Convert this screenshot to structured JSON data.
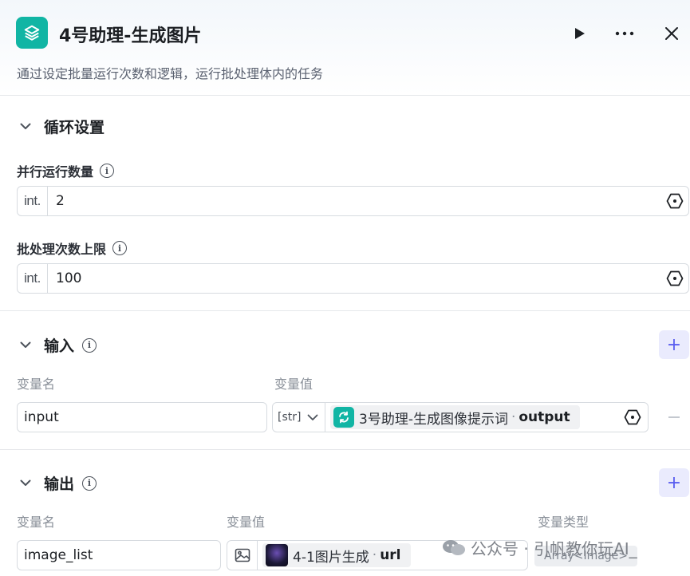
{
  "header": {
    "title": "4号助理-生成图片",
    "description": "通过设定批量运行次数和逻辑，运行批处理体内的任务"
  },
  "loop": {
    "section_title": "循环设置",
    "parallel": {
      "label": "并行运行数量",
      "type": "int.",
      "value": "2"
    },
    "max_batch": {
      "label": "批处理次数上限",
      "type": "int.",
      "value": "100"
    }
  },
  "input": {
    "section_title": "输入",
    "col_name": "变量名",
    "col_value": "变量值",
    "rows": [
      {
        "name": "input",
        "type": "[str]",
        "ref_node": "3号助理-生成图像提示词",
        "ref_var": "output"
      }
    ]
  },
  "output": {
    "section_title": "输出",
    "col_name": "变量名",
    "col_value": "变量值",
    "col_type": "变量类型",
    "rows": [
      {
        "name": "image_list",
        "ref_node": "4-1图片生成",
        "ref_var": "url",
        "var_type": "Array<Image>"
      }
    ]
  },
  "watermark": "公众号 · 引帆教你玩AI_",
  "icons": {
    "logo": "layers-icon",
    "run": "play-icon",
    "more": "more-icon",
    "close": "close-icon"
  },
  "colors": {
    "accent": "#5a5ef0",
    "brand": "#11b5a4"
  }
}
